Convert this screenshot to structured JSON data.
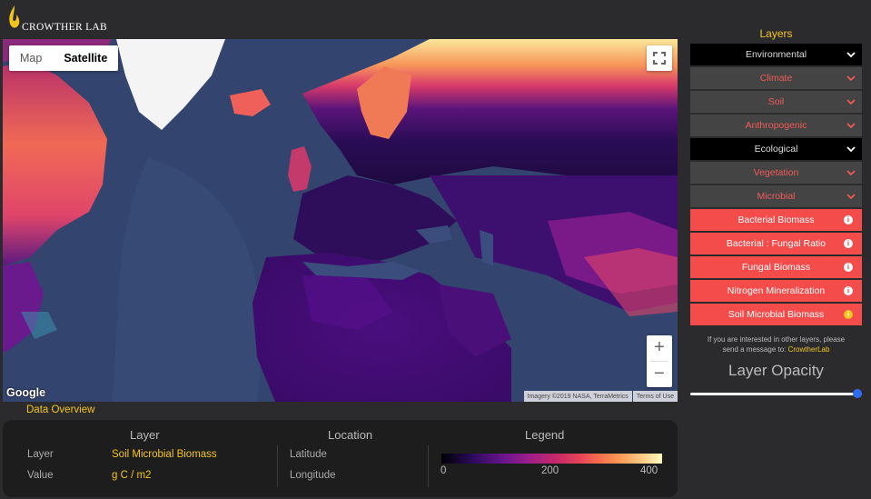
{
  "header": {
    "logo_text": "CROWTHER LAB",
    "flame_icon": "flame-icon"
  },
  "map": {
    "map_type": {
      "map_label": "Map",
      "satellite_label": "Satellite",
      "selected": "Satellite"
    },
    "google_logo": "Google",
    "attribution": {
      "imagery": "Imagery ©2019 NASA, TerraMetrics",
      "terms": "Terms of Use"
    },
    "zoom_in": "+",
    "zoom_out": "−"
  },
  "overview": {
    "title": "Data Overview",
    "layer_header": "Layer",
    "location_header": "Location",
    "legend_header": "Legend",
    "layer_label": "Layer",
    "layer_value": "Soil Microbial Biomass",
    "value_label": "Value",
    "value_unit": "g C / m2",
    "latitude_label": "Latitude",
    "longitude_label": "Longitude",
    "legend_ticks": [
      "0",
      "200",
      "400"
    ],
    "legend_colors": [
      "#000004",
      "#6a158c",
      "#c52968",
      "#f6704a",
      "#fcfdbf"
    ]
  },
  "panel": {
    "title": "Layers",
    "rows": [
      {
        "kind": "cat",
        "label": "Environmental",
        "expanded": true
      },
      {
        "kind": "sub",
        "label": "Climate"
      },
      {
        "kind": "sub",
        "label": "Soil"
      },
      {
        "kind": "sub",
        "label": "Anthropogenic"
      },
      {
        "kind": "cat",
        "label": "Ecological",
        "expanded": true
      },
      {
        "kind": "sub",
        "label": "Vegetation"
      },
      {
        "kind": "sub",
        "label": "Microbial"
      },
      {
        "kind": "item",
        "label": "Bacterial Biomass"
      },
      {
        "kind": "item",
        "label": "Bacterial : Fungal Ratio"
      },
      {
        "kind": "item",
        "label": "Fungal Biomass"
      },
      {
        "kind": "item",
        "label": "Nitrogen Mineralization"
      },
      {
        "kind": "item",
        "label": "Soil Microbial Biomass",
        "selected": true
      }
    ],
    "message_line1": "If you are interested in other layers, please",
    "message_line2": "send a message to: ",
    "message_link": "CrowtherLab",
    "opacity_title": "Layer Opacity",
    "opacity_value": 1.0
  },
  "colors": {
    "accent": "#f2c51c",
    "item_red": "#f44b4b",
    "sub_text": "#f05a5a",
    "slider": "#2d6cf0"
  }
}
